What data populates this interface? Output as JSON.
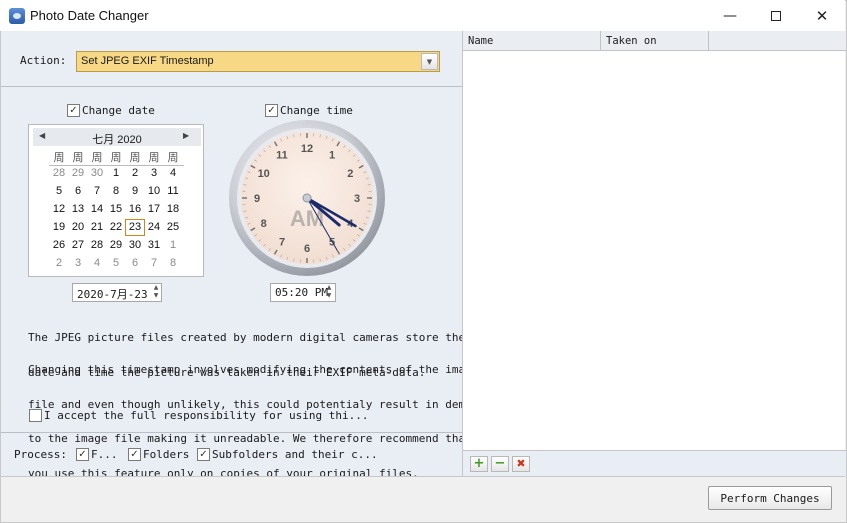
{
  "window": {
    "title": "Photo Date Changer",
    "minimize_icon": "minimize-icon",
    "maximize_icon": "maximize-icon",
    "close_icon": "close-icon"
  },
  "action": {
    "label": "Action:",
    "selected": "Set JPEG EXIF Timestamp"
  },
  "date": {
    "checkbox_label": "Change date",
    "checked": true,
    "field_value": "2020-7月-23",
    "calendar": {
      "month_label": "七月 2020",
      "weekdays": [
        "周",
        "周",
        "周",
        "周",
        "周",
        "周",
        "周"
      ],
      "weeks": [
        [
          {
            "d": "28",
            "o": true
          },
          {
            "d": "29",
            "o": true
          },
          {
            "d": "30",
            "o": true
          },
          {
            "d": "1"
          },
          {
            "d": "2"
          },
          {
            "d": "3"
          },
          {
            "d": "4"
          }
        ],
        [
          {
            "d": "5"
          },
          {
            "d": "6"
          },
          {
            "d": "7"
          },
          {
            "d": "8"
          },
          {
            "d": "9"
          },
          {
            "d": "10"
          },
          {
            "d": "11"
          }
        ],
        [
          {
            "d": "12"
          },
          {
            "d": "13"
          },
          {
            "d": "14"
          },
          {
            "d": "15"
          },
          {
            "d": "16"
          },
          {
            "d": "17"
          },
          {
            "d": "18"
          }
        ],
        [
          {
            "d": "19"
          },
          {
            "d": "20"
          },
          {
            "d": "21"
          },
          {
            "d": "22"
          },
          {
            "d": "23",
            "s": true
          },
          {
            "d": "24"
          },
          {
            "d": "25"
          }
        ],
        [
          {
            "d": "26"
          },
          {
            "d": "27"
          },
          {
            "d": "28"
          },
          {
            "d": "29"
          },
          {
            "d": "30"
          },
          {
            "d": "31"
          },
          {
            "d": "1",
            "o": true
          }
        ],
        [
          {
            "d": "2",
            "o": true
          },
          {
            "d": "3",
            "o": true
          },
          {
            "d": "4",
            "o": true
          },
          {
            "d": "5",
            "o": true
          },
          {
            "d": "6",
            "o": true
          },
          {
            "d": "7",
            "o": true
          },
          {
            "d": "8",
            "o": true
          }
        ]
      ]
    }
  },
  "time": {
    "checkbox_label": "Change time",
    "checked": true,
    "field_value": "05:20 PM",
    "clock": {
      "numbers": [
        "12",
        "1",
        "2",
        "3",
        "4",
        "5",
        "6",
        "7",
        "8",
        "9",
        "10",
        "11"
      ],
      "ampm": "AM",
      "hour": 4,
      "minute": 20,
      "second": 25
    }
  },
  "description": {
    "para1": [
      "The JPEG picture files created by modern digital cameras store the",
      "date and time the picture was taken in their EXIF meta-data."
    ],
    "para2": [
      "Changing this timestamp involves modifying the contents of the image",
      "file and even though unlikely, this could potentialy result in demage",
      "to the image file making it unreadable. We therefore recommend that",
      "you use this feature only on copies of your original files."
    ]
  },
  "accept": {
    "label": "I accept the full responsibility for using thi...",
    "checked": false
  },
  "process": {
    "label": "Process:",
    "options": [
      {
        "label": "F...",
        "checked": true
      },
      {
        "label": "Folders",
        "checked": true
      },
      {
        "label": "Subfolders and their c...",
        "checked": true
      }
    ]
  },
  "file_list": {
    "columns": [
      "Name",
      "Taken on"
    ],
    "rows": [],
    "toolbar": {
      "add_icon": "add-icon",
      "remove_icon": "remove-icon",
      "clear_icon": "clear-icon"
    }
  },
  "perform_button": "Perform Changes",
  "colors": {
    "action_highlight": "#f7d985",
    "panel_bg": "#e9edf4",
    "hand_color": "#1c2b6b",
    "selected_day_border": "#d2841c"
  }
}
